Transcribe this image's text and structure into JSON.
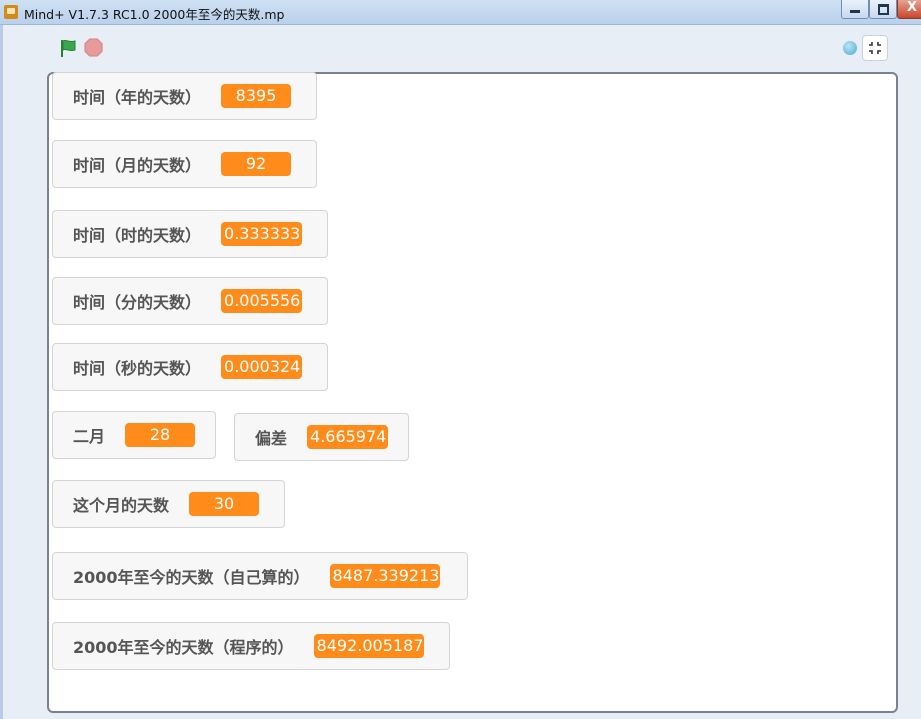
{
  "window": {
    "title": "Mind+ V1.7.3 RC1.0   2000年至今的天数.mp",
    "close_glyph": "X"
  },
  "toolbar": {
    "green_flag_icon": "green-flag-icon",
    "stop_icon": "stop-icon",
    "colors": {
      "flag": "#2f9e44",
      "stop": "#e8999a"
    }
  },
  "monitors": [
    {
      "label": "时间（年的天数）",
      "value": "8395"
    },
    {
      "label": "时间（月的天数）",
      "value": "92"
    },
    {
      "label": "时间（时的天数）",
      "value": "0.333333"
    },
    {
      "label": "时间（分的天数）",
      "value": "0.005556"
    },
    {
      "label": "时间（秒的天数）",
      "value": "0.000324"
    },
    {
      "label": "二月",
      "value": "28"
    },
    {
      "label": "偏差",
      "value": "4.665974"
    },
    {
      "label": "这个月的天数",
      "value": "30"
    },
    {
      "label": "2000年至今的天数（自己算的）",
      "value": "8487.339213"
    },
    {
      "label": "2000年至今的天数（程序的）",
      "value": "8492.005187"
    }
  ],
  "colors": {
    "value_bg": "#ff8c1a",
    "monitor_bg": "#f7f7f7"
  }
}
